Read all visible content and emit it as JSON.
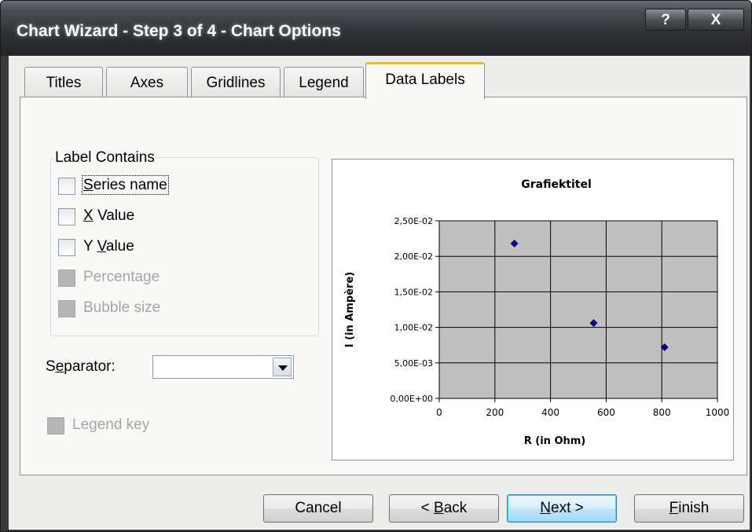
{
  "window": {
    "title": "Chart Wizard - Step 3 of 4 - Chart Options",
    "help_label": "?",
    "close_label": "X"
  },
  "tabs": [
    {
      "label": "Titles",
      "selected": false
    },
    {
      "label": "Axes",
      "selected": false
    },
    {
      "label": "Gridlines",
      "selected": false
    },
    {
      "label": "Legend",
      "selected": false
    },
    {
      "label": "Data Labels",
      "selected": true
    }
  ],
  "label_contains": {
    "title": "Label Contains",
    "options": [
      {
        "label": "Series name",
        "checked": false,
        "enabled": true
      },
      {
        "label": "X Value",
        "checked": false,
        "enabled": true
      },
      {
        "label": "Y Value",
        "checked": false,
        "enabled": true
      },
      {
        "label": "Percentage",
        "checked": false,
        "enabled": false
      },
      {
        "label": "Bubble size",
        "checked": false,
        "enabled": false
      }
    ]
  },
  "separator": {
    "label": "Separator:",
    "value": ""
  },
  "legend_key": {
    "label": "Legend key",
    "checked": false,
    "enabled": false
  },
  "buttons": {
    "cancel": "Cancel",
    "back": "< Back",
    "next": "Next >",
    "finish": "Finish"
  },
  "chart_data": {
    "type": "scatter",
    "title": "Grafiektitel",
    "xlabel": "R (in Ohm)",
    "ylabel": "I (in Ampère)",
    "xlim": [
      0,
      1000
    ],
    "ylim": [
      0,
      0.025
    ],
    "xticks": [
      0,
      200,
      400,
      600,
      800,
      1000
    ],
    "xtick_labels": [
      "0",
      "200",
      "400",
      "600",
      "800",
      "1000"
    ],
    "yticks": [
      0,
      0.005,
      0.01,
      0.015,
      0.02,
      0.025
    ],
    "ytick_labels": [
      "0,00E+00",
      "5,00E-03",
      "1,00E-02",
      "1,50E-02",
      "2,00E-02",
      "2,50E-02"
    ],
    "grid": true,
    "plot_background": "#c0c0c0",
    "marker_color": "#000080",
    "series": [
      {
        "x": [
          270,
          555,
          810
        ],
        "y": [
          0.0218,
          0.0106,
          0.0072
        ]
      }
    ]
  }
}
